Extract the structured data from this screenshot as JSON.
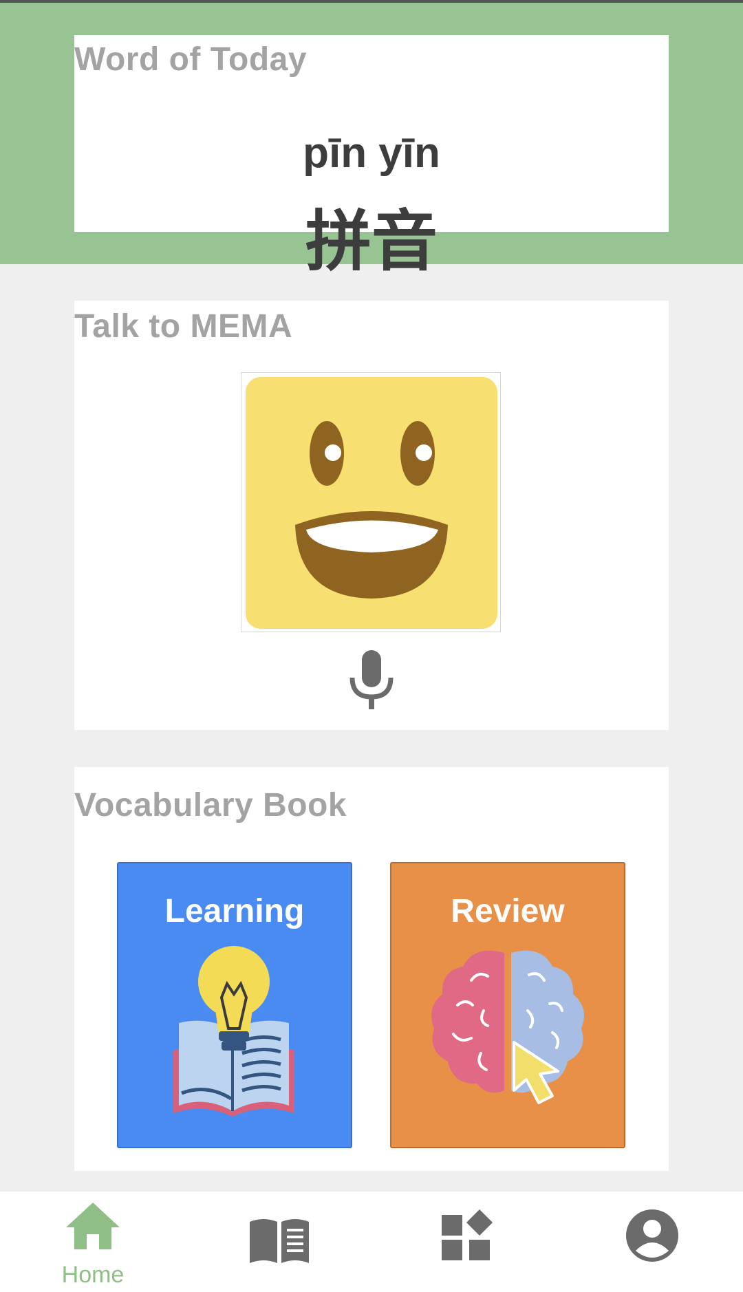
{
  "word_of_today": {
    "title": "Word of Today",
    "pinyin": "pīn yīn",
    "hanzi": "拼音"
  },
  "talk": {
    "title": "Talk to MEMA",
    "avatar_icon": "smiling-face-icon",
    "mic_icon": "microphone-icon"
  },
  "vocabulary": {
    "title": "Vocabulary Book",
    "learning_label": "Learning",
    "review_label": "Review"
  },
  "tabbar": {
    "active_color": "#8fbf87",
    "inactive_color": "#6b6b6b",
    "tabs": [
      {
        "icon": "home-icon",
        "label": "Home",
        "active": true
      },
      {
        "icon": "book-icon",
        "label": "",
        "active": false
      },
      {
        "icon": "widgets-icon",
        "label": "",
        "active": false
      },
      {
        "icon": "account-icon",
        "label": "",
        "active": false
      }
    ]
  },
  "colors": {
    "header_bg": "#98c494",
    "learning_bg": "#4a8bf2",
    "review_bg": "#e88f48",
    "avatar_bg": "#f8df72"
  }
}
